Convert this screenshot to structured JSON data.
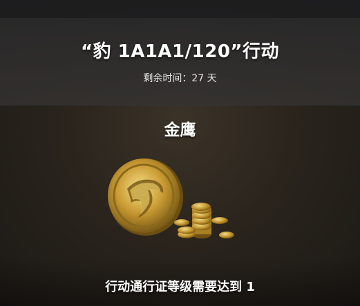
{
  "header": {
    "title": "“豹 1A1A1/120”行动",
    "remaining_time": "剩余时间：27 天"
  },
  "reward": {
    "name": "金鹰",
    "icon": "gold-eagle-coins-icon",
    "requirement": "行动通行证等级需要达到 1"
  },
  "colors": {
    "gold": "#d9b04a",
    "gold_dark": "#8a6a1c"
  }
}
